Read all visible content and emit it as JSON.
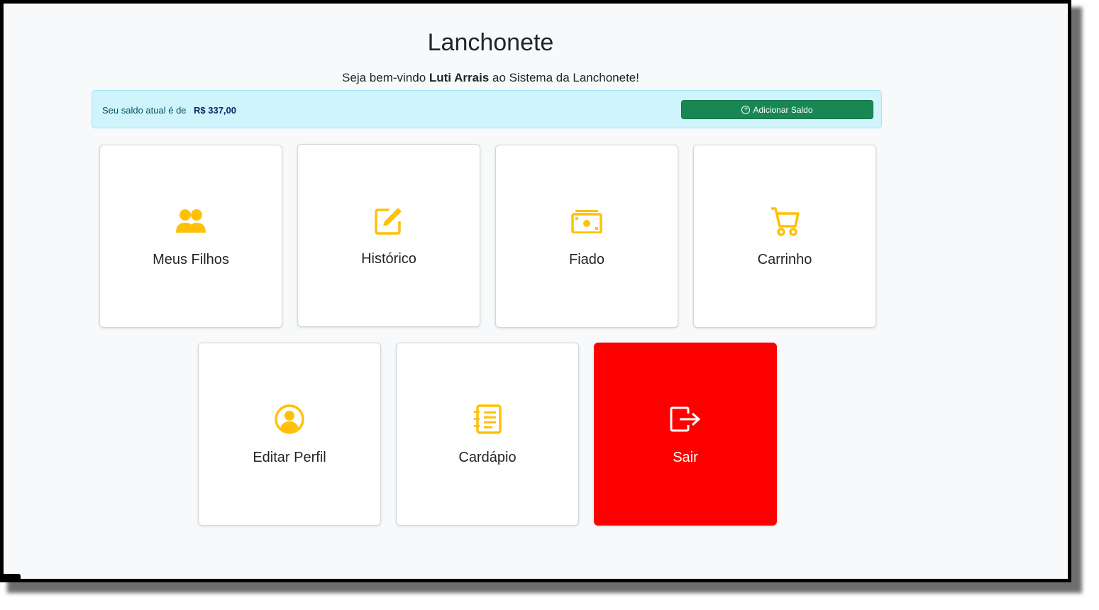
{
  "header": {
    "title": "Lanchonete",
    "welcome_prefix": "Seja bem-vindo ",
    "user_name": "Luti Arrais",
    "welcome_suffix": " ao Sistema da Lanchonete!"
  },
  "balance": {
    "label": "Seu saldo atual é de",
    "value": "R$ 337,00",
    "add_button_label": "Adicionar Saldo"
  },
  "colors": {
    "icon_accent": "#ffc107",
    "exit_card": "#ff0000",
    "add_button": "#198754"
  },
  "cards": [
    {
      "label": "Meus Filhos",
      "icon": "people-icon"
    },
    {
      "label": "Histórico",
      "icon": "edit-icon"
    },
    {
      "label": "Fiado",
      "icon": "cash-icon"
    },
    {
      "label": "Carrinho",
      "icon": "cart-icon"
    },
    {
      "label": "Editar Perfil",
      "icon": "user-circle-icon"
    },
    {
      "label": "Cardápio",
      "icon": "menu-list-icon"
    },
    {
      "label": "Sair",
      "icon": "logout-icon"
    }
  ]
}
